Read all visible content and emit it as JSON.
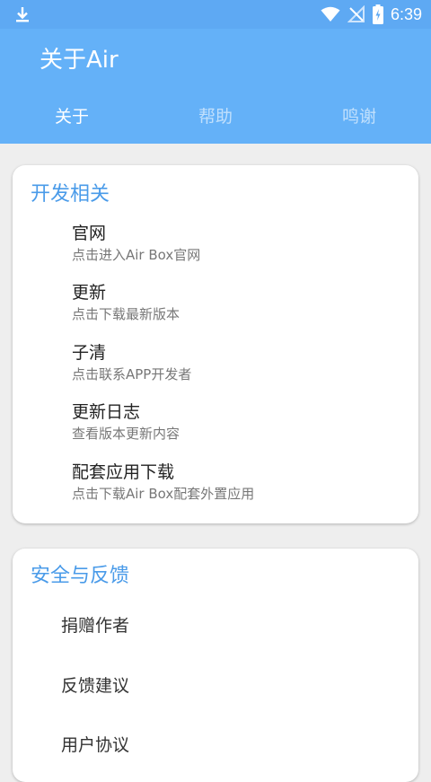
{
  "status": {
    "time": "6:39",
    "icons": [
      "download-icon",
      "wifi-icon",
      "no-signal-icon",
      "battery-charging-icon"
    ]
  },
  "appbar": {
    "title": "关于Air",
    "tabs": [
      {
        "label": "关于",
        "active": true
      },
      {
        "label": "帮助",
        "active": false
      },
      {
        "label": "鸣谢",
        "active": false
      }
    ]
  },
  "section1": {
    "title": "开发相关",
    "items": [
      {
        "title": "官网",
        "subtitle": "点击进入Air Box官网"
      },
      {
        "title": "更新",
        "subtitle": "点击下载最新版本"
      },
      {
        "title": "子清",
        "subtitle": "点击联系APP开发者"
      },
      {
        "title": "更新日志",
        "subtitle": "查看版本更新内容"
      },
      {
        "title": "配套应用下载",
        "subtitle": "点击下载Air Box配套外置应用"
      }
    ]
  },
  "section2": {
    "title": "安全与反馈",
    "items": [
      {
        "title": "捐赠作者"
      },
      {
        "title": "反馈建议"
      },
      {
        "title": "用户协议"
      }
    ]
  },
  "colors": {
    "appbar": "#64b1f8",
    "statusbar": "#5ea9f3",
    "section_title": "#4a9be9"
  }
}
